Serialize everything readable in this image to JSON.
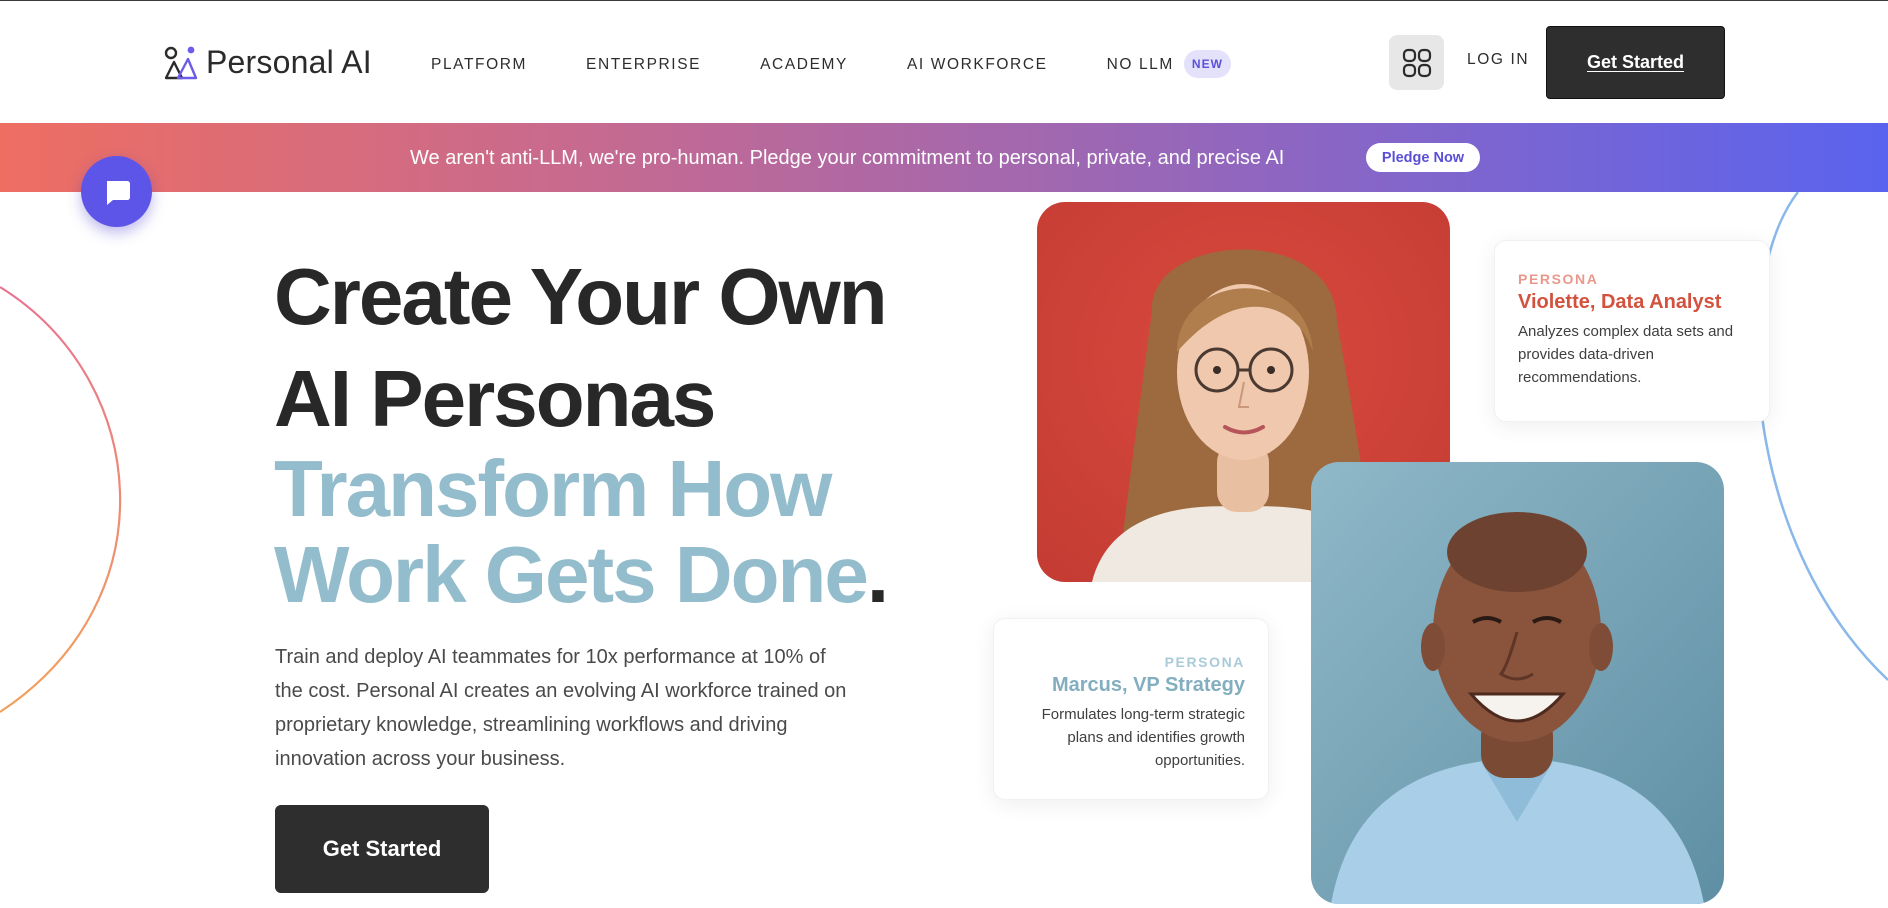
{
  "header": {
    "brand": "Personal AI",
    "nav": [
      {
        "label": "PLATFORM"
      },
      {
        "label": "ENTERPRISE"
      },
      {
        "label": "ACADEMY"
      },
      {
        "label": "AI WORKFORCE"
      },
      {
        "label": "NO LLM",
        "badge": "NEW"
      }
    ],
    "login_label": "LOG IN",
    "cta_label": "Get Started"
  },
  "banner": {
    "text": "We aren't anti-LLM, we're pro-human. Pledge your commitment to personal, private, and precise AI",
    "button_label": "Pledge Now"
  },
  "hero": {
    "title_line1": "Create Your Own",
    "title_line2": "AI Personas",
    "subtitle_line1": "Transform How",
    "subtitle_line2": "Work Gets Done",
    "subtitle_dot": ".",
    "description": "Train and deploy AI teammates for 10x performance at 10% of the cost. Personal AI creates an evolving AI workforce trained on proprietary knowledge, streamlining workflows and driving innovation across your business.",
    "cta_label": "Get Started"
  },
  "personas": [
    {
      "kicker": "PERSONA",
      "name": "Violette, Data Analyst",
      "description": "Analyzes complex data sets and provides data-driven recommendations."
    },
    {
      "kicker": "PERSONA",
      "name": "Marcus, VP Strategy",
      "description": "Formulates long-term strategic plans and identifies growth opportunities."
    }
  ],
  "colors": {
    "dark": "#2e2e2e",
    "accent_blue": "#93bccc",
    "accent_red": "#d2523e",
    "brand_purple": "#5c55e8",
    "banner_start": "#ee6e62",
    "banner_end": "#5a63ee"
  },
  "icons": {
    "logo": "personal-ai-logo-icon",
    "apps": "apps-grid-icon",
    "chat": "chat-bubble-icon"
  }
}
